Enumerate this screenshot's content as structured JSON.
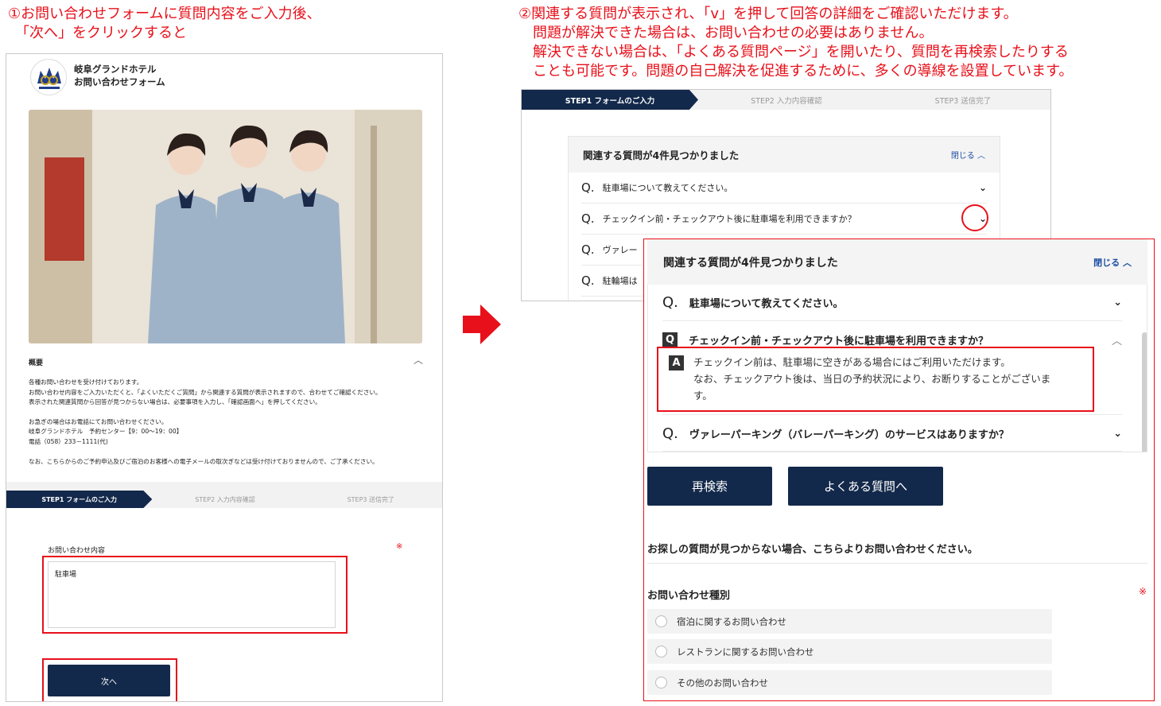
{
  "captions": {
    "left": "①お問い合わせフォームに質問内容をご入力後、\n　「次へ」をクリックすると",
    "right": "②関連する質問が表示され、「v」を押して回答の詳細をご確認いただけます。\n　問題が解決できた場合は、お問い合わせの必要はありません。\n　解決できない場合は、「よくある質問ページ」を開いたり、質問を再検索したりする\n　ことも可能です。問題の自己解決を促進するために、多くの導線を設置しています。"
  },
  "form": {
    "hotel_name": "岐阜グランドホテル",
    "form_title": "お問い合わせフォーム",
    "overview_label": "概要",
    "overview_lines": [
      "各種お問い合わせを受け付けております。",
      "お問い合わせ内容をご入力いただくと、「よくいただくご質問」から関連する質問が表示されますので、合わせてご確認ください。",
      "表示された関連質問から回答が見つからない場合は、必要事項を入力し、「確認画面へ」を押してください。",
      "お急ぎの場合はお電話にてお問い合わせください。",
      "岐阜グランドホテル　予約センター【9：00〜19：00】",
      "電話（058）233－1111(代)",
      "なお、こちらからのご予約申込及びご宿泊のお客様への電子メールの取次ぎなどは受け付けておりませんので、ご了承ください。"
    ],
    "inquiry_label": "お問い合わせ内容",
    "required_mark": "※",
    "inquiry_value": "駐車場",
    "next_button": "次へ"
  },
  "steps": [
    "STEP1 フォームのご入力",
    "STEP2 入力内容確認",
    "STEP3 送信完了"
  ],
  "related": {
    "title": "関連する質問が4件見つかりました",
    "close_label": "閉じる",
    "q_mark": "Q.",
    "q_badge": "Q",
    "a_badge": "A",
    "questions": [
      "駐車場について教えてください。",
      "チェックイン前・チェックアウト後に駐車場を利用できますか？",
      "ヴァレーパーキング（バレーパーキング）のサービスはありますか？",
      "駐輪場は"
    ],
    "small_third": "ヴァレー",
    "answer_lines": [
      "チェックイン前は、駐車場に空きがある場合にはご利用いただけます。",
      "なお、チェックアウト後は、当日の予約状況により、お断りすることがございま",
      "す。"
    ],
    "research_button": "再検索",
    "faq_button": "よくある質問へ",
    "not_found_text": "お探しの質問が見つからない場合、こちらよりお問い合わせください。",
    "type_label": "お問い合わせ種別",
    "options": [
      "宿泊に関するお問い合わせ",
      "レストランに関するお問い合わせ",
      "その他のお問い合わせ"
    ]
  },
  "colors": {
    "navy": "#13294b",
    "red": "#e8101a",
    "link": "#1d4fa3"
  }
}
